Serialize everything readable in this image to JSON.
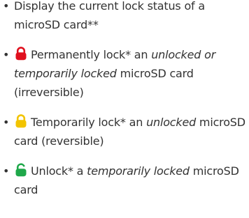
{
  "items": [
    {
      "text1": "Display the current lock status of a microSD card**"
    },
    {
      "icon": "red-lock-icon",
      "icon_color": "#e0101e",
      "text1": "Permanently lock* an ",
      "emph1": "unlocked or temporarily locked",
      "text2": " microSD card (irreversible)"
    },
    {
      "icon": "yellow-lock-icon",
      "icon_color": "#f2c400",
      "text1": "Temporarily lock* an ",
      "emph1": "unlocked",
      "text2": " microSD card (reversible)"
    },
    {
      "icon": "green-unlock-icon",
      "icon_color": "#1fa84a",
      "text1": "Unlock* a ",
      "emph1": "temporarily locked",
      "text2": " microSD card"
    }
  ],
  "bullet": "•"
}
